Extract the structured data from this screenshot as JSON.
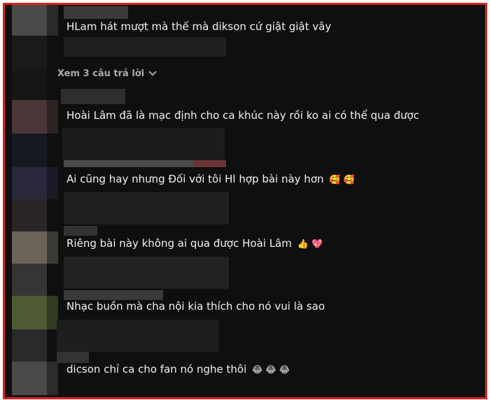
{
  "comments": [
    {
      "text": "HLam hát mượt mà thế mà dikson cứ giật giật vây",
      "emojis": ""
    },
    {
      "text": "Hoài Lâm đã là mạc định cho ca khúc này rồi ko ai có thể qua được",
      "emojis": ""
    },
    {
      "text": "Ai cũng hay nhưng Đối với tôi Hl hợp bài này hơn",
      "emojis": "🥰 🥰"
    },
    {
      "text": "Riêng bài này không ai qua được Hoài Lâm",
      "emojis": "👍 💖"
    },
    {
      "text": "Nhạc buồn mà cha nội kia thích cho nó vui là sao",
      "emojis": ""
    },
    {
      "text": "dicson chỉ ca cho fan nó nghe thôi",
      "emojis": "😂 😂 😂"
    }
  ],
  "view_replies_label": "Xem 3 câu trả lời",
  "colors": {
    "background": "#0f0f0f",
    "text": "#f1f1f1",
    "muted": "#aaaaaa",
    "border": "#e02020"
  }
}
